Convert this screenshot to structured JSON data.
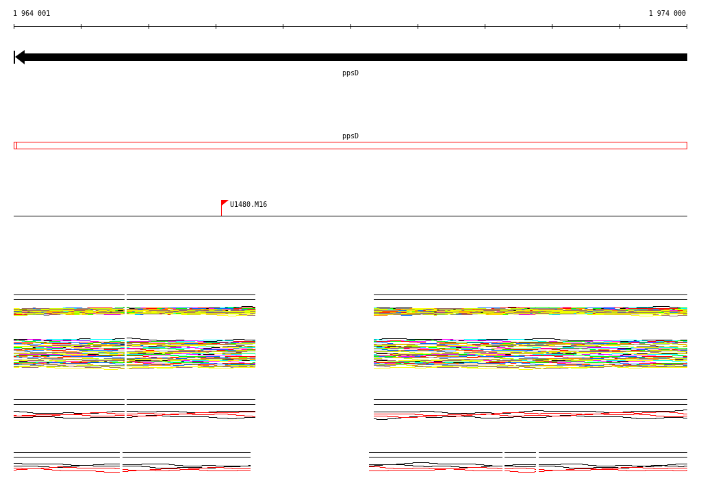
{
  "ruler": {
    "start_label": "1 964 001",
    "end_label": "1 974 000"
  },
  "gene": {
    "name": "ppsD",
    "reverse_strand": true
  },
  "feature": {
    "name": "ppsD"
  },
  "marker": {
    "label": "U1480.M16"
  },
  "tracks": [
    {
      "kind": "bundle_lined"
    },
    {
      "kind": "bundle"
    },
    {
      "kind": "pair_lined"
    },
    {
      "kind": "pair_lined_split"
    }
  ]
}
